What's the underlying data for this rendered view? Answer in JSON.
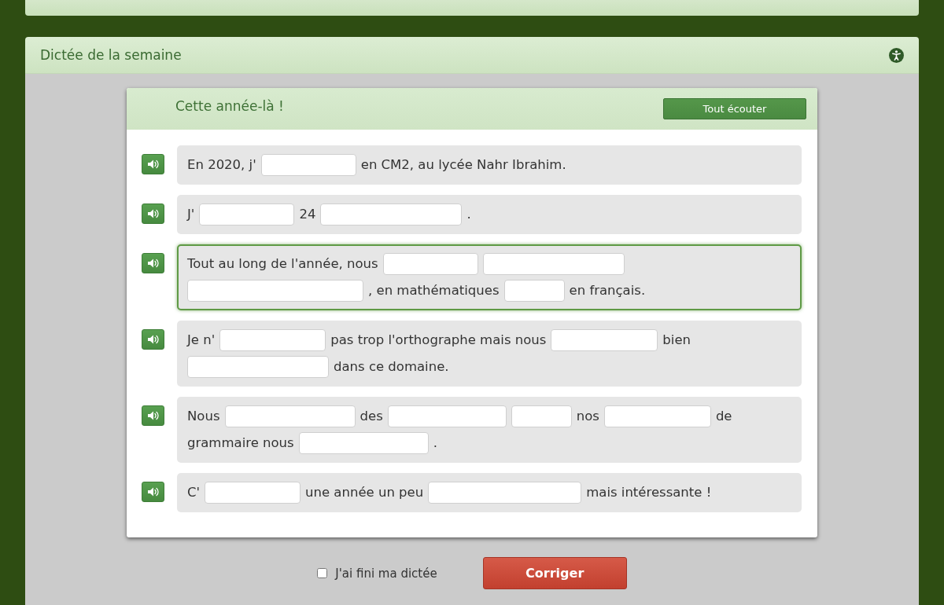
{
  "panel": {
    "title": "Dictée de la semaine"
  },
  "dictation": {
    "title": "Cette année-là !",
    "listen_all_button": "Tout écouter",
    "sentences": [
      {
        "highlighted": false,
        "parts": [
          {
            "kind": "text",
            "text": "En 2020, j'"
          },
          {
            "kind": "blank"
          },
          {
            "kind": "text",
            "text": "en CM2, au lycée Nahr Ibrahim."
          }
        ]
      },
      {
        "highlighted": false,
        "parts": [
          {
            "kind": "text",
            "text": "J'"
          },
          {
            "kind": "blank"
          },
          {
            "kind": "text",
            "text": "24"
          },
          {
            "kind": "blank"
          },
          {
            "kind": "text",
            "text": "."
          }
        ]
      },
      {
        "highlighted": true,
        "parts": [
          {
            "kind": "text",
            "text": "Tout au long de l'année, nous"
          },
          {
            "kind": "blank"
          },
          {
            "kind": "blank"
          },
          {
            "kind": "blank"
          },
          {
            "kind": "text",
            "text": ", en mathématiques"
          },
          {
            "kind": "blank"
          },
          {
            "kind": "text",
            "text": "en français."
          }
        ]
      },
      {
        "highlighted": false,
        "parts": [
          {
            "kind": "text",
            "text": "Je n'"
          },
          {
            "kind": "blank"
          },
          {
            "kind": "text",
            "text": "pas trop l'orthographe mais nous"
          },
          {
            "kind": "blank"
          },
          {
            "kind": "text",
            "text": "bien"
          },
          {
            "kind": "blank"
          },
          {
            "kind": "text",
            "text": "dans ce domaine."
          }
        ]
      },
      {
        "highlighted": false,
        "parts": [
          {
            "kind": "text",
            "text": "Nous"
          },
          {
            "kind": "blank"
          },
          {
            "kind": "text",
            "text": "des"
          },
          {
            "kind": "blank"
          },
          {
            "kind": "blank"
          },
          {
            "kind": "text",
            "text": "nos"
          },
          {
            "kind": "blank"
          },
          {
            "kind": "text",
            "text": "de"
          },
          {
            "kind": "text",
            "text": "grammaire nous"
          },
          {
            "kind": "blank"
          },
          {
            "kind": "text",
            "text": "."
          }
        ]
      },
      {
        "highlighted": false,
        "parts": [
          {
            "kind": "text",
            "text": "C'"
          },
          {
            "kind": "blank"
          },
          {
            "kind": "text",
            "text": "une année un peu"
          },
          {
            "kind": "blank"
          },
          {
            "kind": "text",
            "text": "mais intéressante !"
          }
        ]
      }
    ]
  },
  "finished": {
    "label": "J'ai fini ma dictée",
    "checked": false
  },
  "correct_button": "Corriger"
}
